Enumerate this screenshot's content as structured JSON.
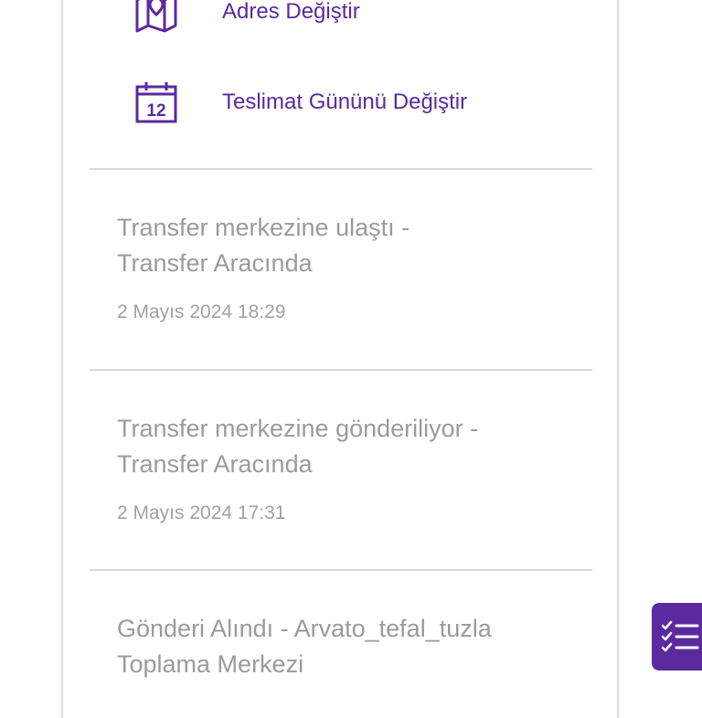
{
  "actions": {
    "change_address": "Adres Değiştir",
    "change_delivery_day": "Teslimat Gününü Değiştir",
    "calendar_day": "12"
  },
  "events": [
    {
      "title_line1": "Transfer merkezine ulaştı -",
      "title_line2": "Transfer Aracında",
      "time": "2 Mayıs 2024 18:29"
    },
    {
      "title_line1": "Transfer merkezine gönderiliyor -",
      "title_line2": "Transfer Aracında",
      "time": "2 Mayıs 2024 17:31"
    },
    {
      "title_line1": "Gönderi Alındı - Arvato_tefal_tuzla",
      "title_line2": "Toplama Merkezi",
      "time": ""
    }
  ],
  "colors": {
    "accent": "#5b2a9e",
    "muted_text": "#9b9b9b",
    "divider": "#d9d9d9"
  },
  "icons": {
    "address": "map-icon",
    "delivery_day": "calendar-icon",
    "fab": "checklist-icon"
  }
}
